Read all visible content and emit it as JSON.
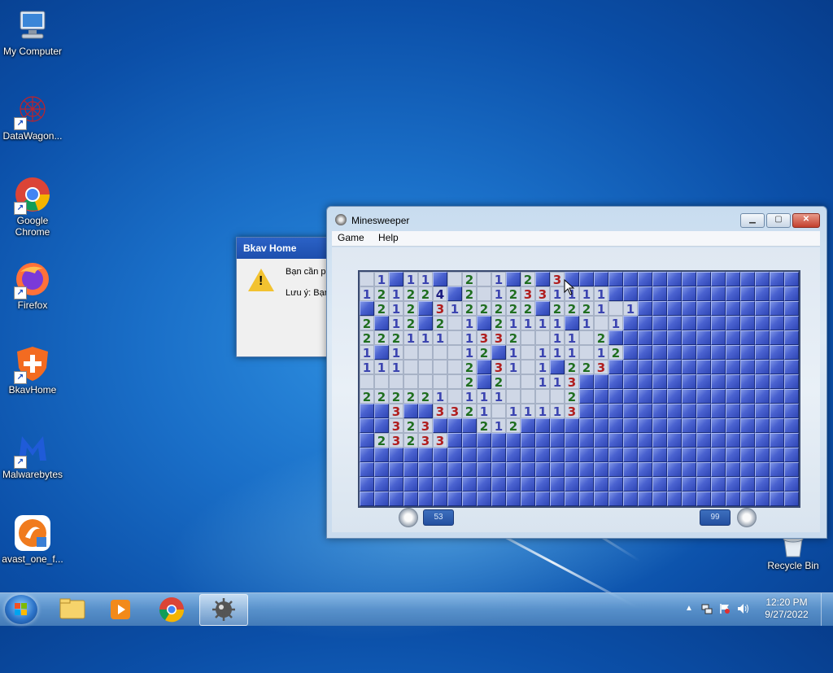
{
  "desktop": {
    "icons": [
      {
        "label": "My Computer"
      },
      {
        "label": "DataWagon..."
      },
      {
        "label": "Google Chrome"
      },
      {
        "label": "Firefox"
      },
      {
        "label": "BkavHome"
      },
      {
        "label": "Malwarebytes"
      },
      {
        "label": "avast_one_f..."
      },
      {
        "label": "Recycle Bin"
      }
    ]
  },
  "bkav_dialog": {
    "title": "Bkav Home",
    "line1": "Bạn cần ph",
    "line2": "Lưu ý: Bạn"
  },
  "minesweeper": {
    "title": "Minesweeper",
    "menu": [
      "Game",
      "Help"
    ],
    "timer": "53",
    "mines_left": "99",
    "rows": [
      "O1C11CO2O1C2C3CCCCCCCCCCCCCCCC",
      "121224C2O12331111CCCCCCCCCCCCC",
      "C212C3122222C2221O1CCCCCCCCCCC",
      "2C12C2O1C21111C1O1CCCCCCCCCCCC",
      "222111O1332OO11O2CCCCCCCCCCCCC",
      "1C1OOOO12C1O111O12CCCCCCCCCCCC",
      "111OOOO2C31O1C223CCCCCCCCCCCCC",
      "OOOOOOO2C2OO113CCCCCCCCCCCCCCC",
      "222221O111OOOO2CCCCCCCCCCCCCCC",
      "CC3CC3321O11113CCCCCCCCCCCCCCC",
      "CC323CCC212CCCCCCCCCCCCCCCCCCC",
      "C23233CCCCCCCCCCCCCCCCCCCCCCCC",
      "CCCCCCCCCCCCCCCCCCCCCCCCCCCCCC",
      "CCCCCCCCCCCCCCCCCCCCCCCCCCCCCC",
      "CCCCCCCCCCCCCCCCCCCCCCCCCCCCCC",
      "CCCCCCCCCCCCCCCCCCCCCCCCCCCCCC"
    ]
  },
  "taskbar": {
    "time": "12:20 PM",
    "date": "9/27/2022"
  },
  "colors": {
    "num1": "#3c45b0",
    "num2": "#1f6e1f",
    "num3": "#b01e1e",
    "num4": "#1a1a80"
  }
}
